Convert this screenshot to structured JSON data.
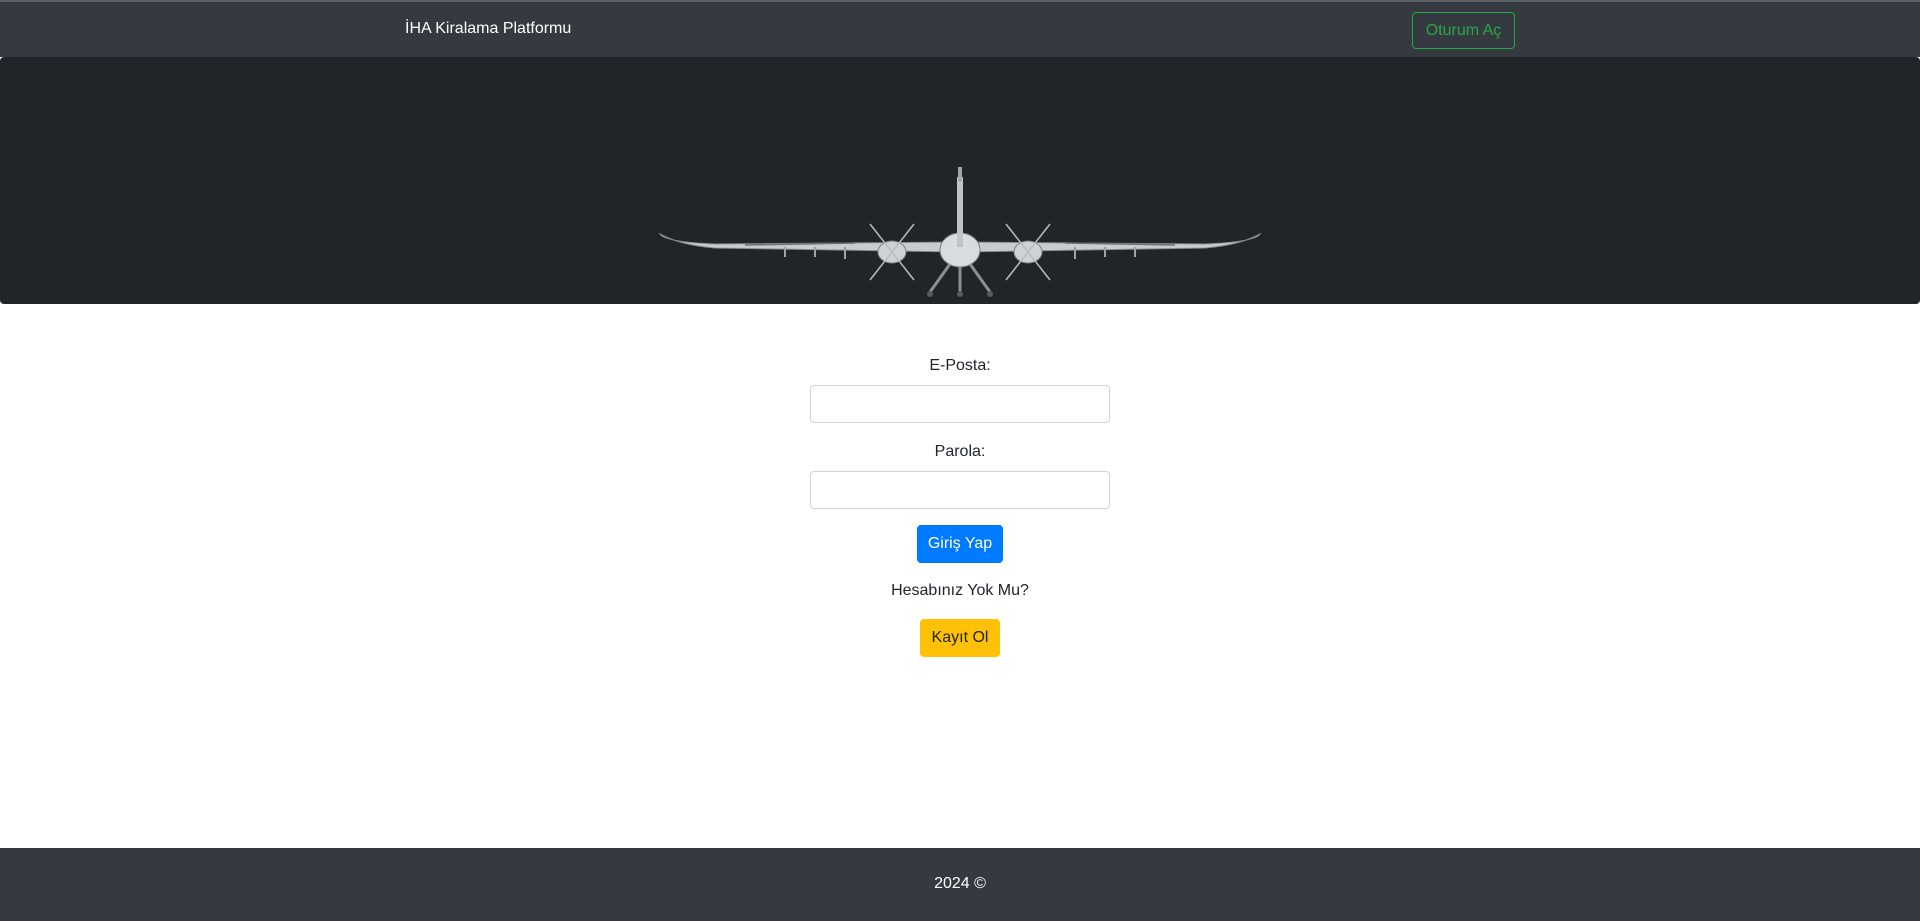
{
  "navbar": {
    "brand": "İHA Kiralama Platformu",
    "login_button": "Oturum Aç"
  },
  "hero": {
    "image": "drone-image"
  },
  "login_form": {
    "email_label": "E-Posta:",
    "email_value": "",
    "password_label": "Parola:",
    "password_value": "",
    "submit_label": "Giriş Yap",
    "no_account_text": "Hesabınız Yok Mu?",
    "register_label": "Kayıt Ol"
  },
  "footer": {
    "text": "2024 ©"
  },
  "colors": {
    "navbar_bg": "#343a40",
    "hero_bg": "#212529",
    "success": "#28a745",
    "primary": "#007bff",
    "warning": "#ffc107"
  }
}
